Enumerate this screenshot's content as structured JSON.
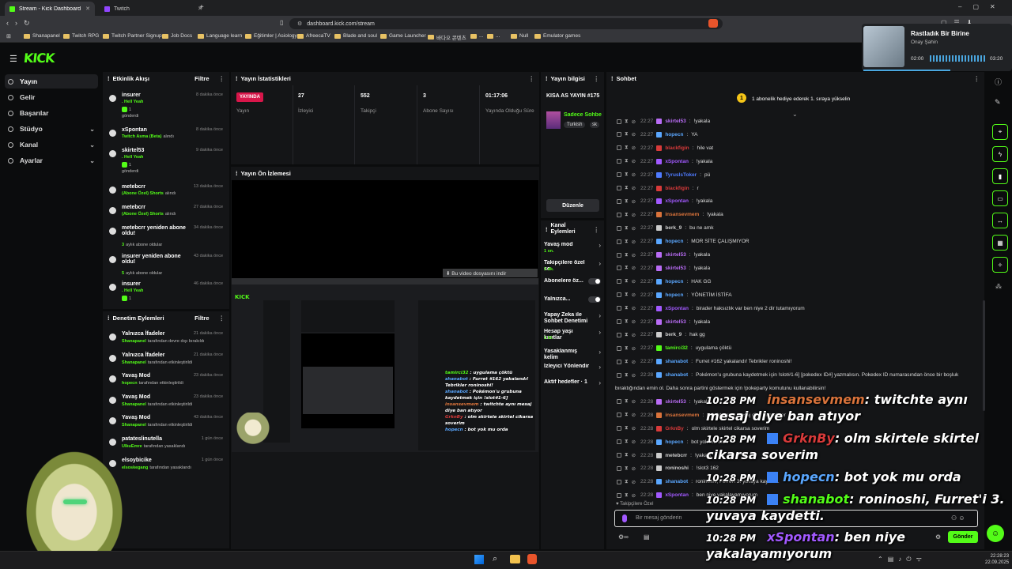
{
  "browser": {
    "tabs": [
      {
        "label": "Stream - Kick Dashboard",
        "color": "#53fc18"
      },
      {
        "label": "Twitch",
        "color": "#9146ff"
      }
    ],
    "url": "dashboard.kick.com/stream",
    "bookmarks": [
      "Shanapanel",
      "Twitch RPG",
      "Twitch Partner Signup",
      "Job Docs",
      "Language learn",
      "Eğitimler | Asiology",
      "AfreecaTV",
      "Blade and soul",
      "Game Launcher",
      "바다오 콘텐츠",
      "...",
      "...",
      "Null",
      "Emulator games"
    ]
  },
  "music": {
    "title": "Rastladık Bir Birine",
    "artist": "Onay Şahin",
    "elapsed": "02:00",
    "total": "03:20",
    "progress": 0.6
  },
  "sidebar": {
    "logo": "KICK",
    "items": [
      {
        "label": "Yayın",
        "expandable": false
      },
      {
        "label": "Gelir",
        "expandable": false
      },
      {
        "label": "Başarılar",
        "expandable": false
      },
      {
        "label": "Stüdyo",
        "expandable": true
      },
      {
        "label": "Kanal",
        "expandable": true
      },
      {
        "label": "Ayarlar",
        "expandable": true
      }
    ]
  },
  "activity": {
    "title": "Etkinlik Akışı",
    "filter": "Filtre",
    "events": [
      {
        "name": "insurer",
        "time": "8 dakika önce",
        "line1": ". Hell Yeah",
        "line2": "gönderdi",
        "count": "1"
      },
      {
        "name": "xSpontan",
        "time": "8 dakika önce",
        "line1": "Twitch Asma (Beta)",
        "line2": "alındı",
        "count": ""
      },
      {
        "name": "skirtel53",
        "time": "9 dakika önce",
        "line1": ". Hell Yeah",
        "line2": "gönderdi",
        "count": "1"
      },
      {
        "name": "metebcrr",
        "time": "13 dakika önce",
        "line1": "(Abone Özel) Shorts",
        "line2": "alındı",
        "count": ""
      },
      {
        "name": "metebcrr",
        "time": "27 dakika önce",
        "line1": "(Abone Özel) Shorts",
        "line2": "alındı",
        "count": ""
      },
      {
        "name": "metebcrr yeniden abone oldu!",
        "time": "34 dakika önce",
        "line1": "3",
        "line2": "aylık abone oldular",
        "count": ""
      },
      {
        "name": "insurer yeniden abone oldu!",
        "time": "43 dakika önce",
        "line1": "5",
        "line2": "aylık abone oldular",
        "count": ""
      },
      {
        "name": "insurer",
        "time": "46 dakika önce",
        "line1": ". Hell Yeah",
        "line2": "",
        "count": "1"
      }
    ]
  },
  "moderation": {
    "title": "Denetim Eylemleri",
    "filter": "Filtre",
    "actions": [
      {
        "name": "Yalnızca İfadeler",
        "time": "21 dakika önce",
        "who": "Shanapanel",
        "what": "tarafından devre dışı bırakıldı"
      },
      {
        "name": "Yalnızca İfadeler",
        "time": "21 dakika önce",
        "who": "Shanapanel",
        "what": "tarafından etkinleştirildi"
      },
      {
        "name": "Yavaş Mod",
        "time": "23 dakika önce",
        "who": "hopecn",
        "what": "tarafından etkinleştirildi"
      },
      {
        "name": "Yavaş Mod",
        "time": "23 dakika önce",
        "who": "Shanapanel",
        "what": "tarafından etkinleştirildi"
      },
      {
        "name": "Yavaş Mod",
        "time": "43 dakika önce",
        "who": "Shanapanel",
        "what": "tarafından etkinleştirildi"
      },
      {
        "name": "patateslinutella",
        "time": "1 gün önce",
        "who": "UlkuEmre",
        "what": "tarafından yasaklandı"
      },
      {
        "name": "elsoybicike",
        "time": "1 gün önce",
        "who": "elsoskegang",
        "what": "tarafından yasaklandı"
      }
    ]
  },
  "stats": {
    "title": "Yayın İstatistikleri",
    "live": "YAYINDA",
    "live_label": "Yayın",
    "viewers": "27",
    "viewers_label": "İzleyici",
    "followers": "552",
    "followers_label": "Takipçi",
    "subs": "3",
    "subs_label": "Abone Sayısı",
    "duration": "01:17:06",
    "duration_label": "Yayında Olduğu Süre"
  },
  "preview": {
    "title": "Yayın Ön İzlemesi"
  },
  "info": {
    "title": "Yayın bilgisi",
    "stream_title": "KISA AS YAYIN #175",
    "category": "Sadece Sohbe",
    "tags": [
      "Turkish",
      "sk"
    ],
    "edit": "Düzenle"
  },
  "channel_actions": {
    "title": "Kanal Eylemleri",
    "items": [
      {
        "label": "Yavaş mod",
        "sub": "1 sn."
      },
      {
        "label": "Takipçilere özel sc",
        "sub": "1 dk."
      },
      {
        "label": "Abonelere öz...",
        "sub": ""
      },
      {
        "label": "Yalnızca...",
        "sub": ""
      },
      {
        "label": "Yapay Zeka ile Sohbet Denetimi",
        "sub": ""
      },
      {
        "label": "Hesap yaşı kısıtlar",
        "sub": "1 hf."
      },
      {
        "label": "Yasaklanmış kelim",
        "sub": ""
      },
      {
        "label": "İzleyici Yönlendir",
        "sub": ""
      },
      {
        "label": "Aktif hedefler · 1",
        "sub": ""
      }
    ]
  },
  "chat": {
    "title": "Sohbet",
    "pinned": "1 abonelik hediye ederek 1. sıraya yükselin",
    "messages": [
      {
        "time": "22:27",
        "user": "skirtel53",
        "color": "#b96cf5",
        "text": "!yakala"
      },
      {
        "time": "22:27",
        "user": "hopecn",
        "color": "#5aa7ff",
        "text": "YA"
      },
      {
        "time": "22:27",
        "user": "blackfigin",
        "color": "#d83a3a",
        "text": "hile vat"
      },
      {
        "time": "22:27",
        "user": "xSpontan",
        "color": "#a259ff",
        "text": "!yakala"
      },
      {
        "time": "22:27",
        "user": "TyrusIsToker",
        "color": "#4f7bff",
        "text": "pü"
      },
      {
        "time": "22:27",
        "user": "blackfigin",
        "color": "#d83a3a",
        "text": "r"
      },
      {
        "time": "22:27",
        "user": "xSpontan",
        "color": "#a259ff",
        "text": "!yakala"
      },
      {
        "time": "22:27",
        "user": "insansevmem",
        "color": "#d9733b",
        "text": "!yakala"
      },
      {
        "time": "22:27",
        "user": "berk_9",
        "color": "#cccccc",
        "text": "bu ne amk"
      },
      {
        "time": "22:27",
        "user": "hopecn",
        "color": "#5aa7ff",
        "text": "MOR SİTE ÇALIŞMIYOR"
      },
      {
        "time": "22:27",
        "user": "skirtel53",
        "color": "#b96cf5",
        "text": "!yakala"
      },
      {
        "time": "22:27",
        "user": "skirtel53",
        "color": "#b96cf5",
        "text": "!yakala"
      },
      {
        "time": "22:27",
        "user": "hopecn",
        "color": "#5aa7ff",
        "text": "HAK GG"
      },
      {
        "time": "22:27",
        "user": "hopecn",
        "color": "#5aa7ff",
        "text": "YÖNETİM İSTİFA"
      },
      {
        "time": "22:27",
        "user": "xSpontan",
        "color": "#a259ff",
        "text": "birader haksızlık var ben niye 2 dir tutamıyorum"
      },
      {
        "time": "22:27",
        "user": "skirtel53",
        "color": "#b96cf5",
        "text": "!yakala"
      },
      {
        "time": "22:27",
        "user": "berk_9",
        "color": "#cccccc",
        "text": "hak gg"
      },
      {
        "time": "22:27",
        "user": "tamirci32",
        "color": "#53fc18",
        "text": "uygulama çöktü"
      },
      {
        "time": "22:27",
        "user": "shanabot",
        "color": "#5aa7ff",
        "text": "Furret #162 yakalandı! Tebrikler roninoshi!"
      },
      {
        "time": "22:28",
        "user": "shanabot",
        "color": "#5aa7ff",
        "text": "Pokémon'u grubuna kaydetmek için !slot#1-6] [pokedex ID#] yazmalısın. Pokedex ID numarasından önce bir boşluk"
      },
      {
        "time": "",
        "user": "",
        "color": "#cccccc",
        "text": "bıraktığından emin ol. Daha sonra partini göstermek için !pokeparty komutunu kullanabilirsin!"
      },
      {
        "time": "22:28",
        "user": "skirtel53",
        "color": "#b96cf5",
        "text": "!yakala"
      },
      {
        "time": "22:28",
        "user": "insansevmem",
        "color": "#d9733b",
        "text": "twitchte aynı mesaj diye ban atıyor"
      },
      {
        "time": "22:28",
        "user": "GrknBy",
        "color": "#d83a3a",
        "text": "olm skirtele skirtel cikarsa soverim"
      },
      {
        "time": "22:28",
        "user": "hopecn",
        "color": "#5aa7ff",
        "text": "bot yok mu orda"
      },
      {
        "time": "22:28",
        "user": "metebcrr",
        "color": "#cccccc",
        "text": "!yakala"
      },
      {
        "time": "22:28",
        "user": "roninoshi",
        "color": "#cccccc",
        "text": "!slot3 162"
      },
      {
        "time": "22:28",
        "user": "shanabot",
        "color": "#5aa7ff",
        "text": "roninoshi, Furret'i 3. yuvaya kaydetti."
      },
      {
        "time": "22:28",
        "user": "xSpontan",
        "color": "#a259ff",
        "text": "ben niye yakalayamıyorum"
      }
    ],
    "followers_only": "Takipçilere Özel",
    "placeholder": "Bir mesaj gönderin",
    "send": "Gönder"
  },
  "overlay": [
    {
      "time": "10:28 PM",
      "user": "insansevmem",
      "color": "#d9733b",
      "text": ": twitchte aynı",
      "cont": "mesaj diye ban atıyor"
    },
    {
      "time": "10:28 PM",
      "user": "GrknBy",
      "color": "#d83a3a",
      "text": ": olm skirtele skirtel",
      "cont": "cikarsa soverim"
    },
    {
      "time": "10:28 PM",
      "user": "hopecn",
      "color": "#5aa7ff",
      "text": ": bot yok mu orda",
      "cont": ""
    },
    {
      "time": "10:28 PM",
      "user": "shanabot",
      "color": "#53fc18",
      "text": ": roninoshi, Furret'i 3.",
      "cont": "yuvaya kaydetti."
    },
    {
      "time": "10:28 PM",
      "user": "xSpontan",
      "color": "#a259ff",
      "text": ": ben niye",
      "cont": "yakalayamıyorum"
    }
  ],
  "taskbar": {
    "time": "22:28:23",
    "date": "22.09.2025"
  },
  "download_hint": "Bu video dosyasını indir"
}
